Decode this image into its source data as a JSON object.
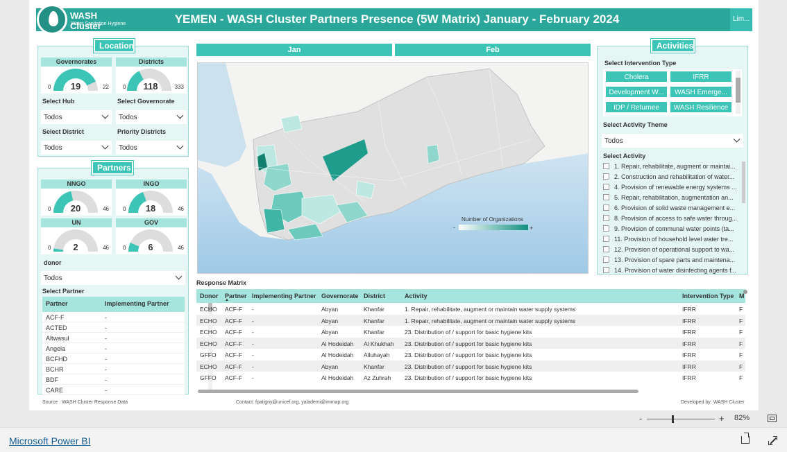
{
  "header": {
    "logo_title": "WASH Cluster",
    "logo_subtitle": "Water Sanitation Hygiene",
    "title": "YEMEN - WASH Cluster Partners Presence (5W Matrix) January - February 2024",
    "lim_button": "Lim..."
  },
  "location": {
    "title": "Location",
    "governorates": {
      "label": "Governorates",
      "value": "19",
      "min": "0",
      "max": "22",
      "fraction": 0.86
    },
    "districts": {
      "label": "Districts",
      "value": "118",
      "min": "0",
      "max": "333",
      "fraction": 0.35
    },
    "select_hub": {
      "label": "Select Hub",
      "value": "Todos"
    },
    "select_governorate": {
      "label": "Select Governorate",
      "value": "Todos"
    },
    "select_district": {
      "label": "Select District",
      "value": "Todos"
    },
    "priority_districts": {
      "label": "Priority Districts",
      "value": "Todos"
    }
  },
  "partners": {
    "title": "Partners",
    "nngo": {
      "label": "NNGO",
      "value": "20",
      "min": "0",
      "max": "46",
      "fraction": 0.43
    },
    "ingo": {
      "label": "INGO",
      "value": "18",
      "min": "0",
      "max": "46",
      "fraction": 0.39
    },
    "un": {
      "label": "UN",
      "value": "2",
      "min": "0",
      "max": "46",
      "fraction": 0.04
    },
    "gov": {
      "label": "GOV",
      "value": "6",
      "min": "0",
      "max": "46",
      "fraction": 0.13
    },
    "donor": {
      "label": "donor",
      "value": "Todos"
    },
    "select_partner_label": "Select Partner",
    "table": {
      "headers": [
        "Partner",
        "Implementing Partner"
      ],
      "rows": [
        [
          "ACF-F",
          "-"
        ],
        [
          "ACTED",
          "-"
        ],
        [
          "Altwasul",
          "-"
        ],
        [
          "Angela",
          "-"
        ],
        [
          "BCFHD",
          "-"
        ],
        [
          "BCHR",
          "-"
        ],
        [
          "BDF",
          "-"
        ],
        [
          "CARE",
          "-"
        ]
      ]
    }
  },
  "months": [
    "Jan",
    "Feb"
  ],
  "map": {
    "legend_title": "Number of Organizations",
    "legend_min": "-",
    "legend_max": "+"
  },
  "activities": {
    "title": "Activities",
    "intervention_label": "Select Intervention Type",
    "intervention_chips": [
      "Cholera",
      "IFRR",
      "Development W...",
      "WASH Emerge...",
      "IDP / Returnee",
      "WASH Resilience"
    ],
    "theme_label": "Select Activity Theme",
    "theme_value": "Todos",
    "activity_label": "Select Activity",
    "items": [
      "1. Repair, rehabilitate, augment or maintai...",
      "2. Construction and rehabilitation of water...",
      "4. Provision of renewable energy systems ...",
      "5. Repair, rehabilitation, augmentation an...",
      "6. Provision of solid waste management e...",
      "8. Provision of access to safe water throug...",
      "9. Provision of communal water points (ta...",
      "11. Provision of household level water tre...",
      "12. Provision of operational support to wa...",
      "13. Provision of spare parts and maintena...",
      "14. Provision of water disinfecting agents f..."
    ]
  },
  "matrix": {
    "title": "Response Matrix",
    "headers": [
      "Donor",
      "Partner",
      "Implementing Partner",
      "Governorate",
      "District",
      "Activity",
      "Intervention Type",
      "M"
    ],
    "rows": [
      [
        "ECHO",
        "ACF-F",
        "-",
        "Abyan",
        "Khanfar",
        "1. Repair, rehabilitate, augment or maintain water supply systems",
        "IFRR",
        "F"
      ],
      [
        "ECHO",
        "ACF-F",
        "-",
        "Abyan",
        "Khanfar",
        "1. Repair, rehabilitate, augment or maintain water supply systems",
        "IFRR",
        "F"
      ],
      [
        "ECHO",
        "ACF-F",
        "-",
        "Abyan",
        "Khanfar",
        "23. Distribution of / support for basic hygiene kits",
        "IFRR",
        "F"
      ],
      [
        "ECHO",
        "ACF-F",
        "-",
        "Al Hodeidah",
        "Al Khukhah",
        "23. Distribution of / support for basic hygiene kits",
        "IFRR",
        "F"
      ],
      [
        "GFFO",
        "ACF-F",
        "-",
        "Al Hodeidah",
        "Alluhayah",
        "23. Distribution of / support for basic hygiene kits",
        "IFRR",
        "F"
      ],
      [
        "ECHO",
        "ACF-F",
        "-",
        "Abyan",
        "Khanfar",
        "23. Distribution of / support for basic hygiene kits",
        "IFRR",
        "F"
      ],
      [
        "GFFO",
        "ACF-F",
        "-",
        "Al Hodeidah",
        "Az Zuhrah",
        "23. Distribution of / support for basic hygiene kits",
        "IFRR",
        "F"
      ]
    ]
  },
  "footer": {
    "source": "Source : WASH Cluster Response Data",
    "contact": "Contact: fpatigny@unicef.org, yalademi@immap.org",
    "developed": "Developed by: WASH Cluster"
  },
  "zoom": {
    "minus": "-",
    "plus": "+",
    "level": "82%"
  },
  "brand": "Microsoft Power BI",
  "colors": {
    "primary": "#2aa69a",
    "accent": "#3cc4b6",
    "light": "#a6e5de"
  }
}
